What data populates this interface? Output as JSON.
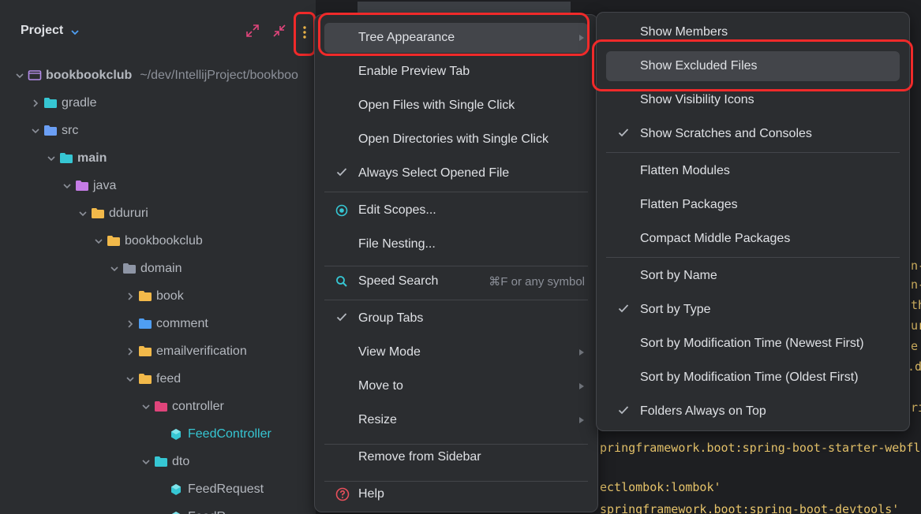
{
  "project_panel": {
    "title": "Project",
    "tree": [
      {
        "label": "bookbookclub",
        "path": "~/dev/IntellijProject/bookboo",
        "bold": true,
        "expanded": true,
        "icon": "module-folder-icon",
        "color": "#b38ce8"
      },
      {
        "label": "gradle",
        "expanded": false,
        "icon": "gradle-folder-icon",
        "color": "#36c6d3"
      },
      {
        "label": "src",
        "expanded": true,
        "icon": "source-folder-icon",
        "color": "#6b9ff5"
      },
      {
        "label": "main",
        "bold": true,
        "expanded": true,
        "icon": "main-folder-icon",
        "color": "#36c6d3"
      },
      {
        "label": "java",
        "expanded": true,
        "icon": "java-folder-icon",
        "color": "#c57ce6"
      },
      {
        "label": "ddururi",
        "expanded": true,
        "icon": "package-folder-icon",
        "color": "#f2b94a"
      },
      {
        "label": "bookbookclub",
        "expanded": true,
        "icon": "package-folder-icon",
        "color": "#f2b94a"
      },
      {
        "label": "domain",
        "expanded": true,
        "icon": "domain-folder-icon",
        "color": "#8e95a5"
      },
      {
        "label": "book",
        "expanded": false,
        "icon": "package-folder-icon",
        "color": "#f2b94a"
      },
      {
        "label": "comment",
        "expanded": false,
        "icon": "comment-folder-icon",
        "color": "#4f9ef2"
      },
      {
        "label": "emailverification",
        "expanded": false,
        "icon": "package-folder-icon",
        "color": "#f2b94a"
      },
      {
        "label": "feed",
        "expanded": true,
        "icon": "package-folder-icon",
        "color": "#f2b94a"
      },
      {
        "label": "controller",
        "expanded": true,
        "icon": "controller-folder-icon",
        "color": "#e0457b"
      },
      {
        "label": "FeedController",
        "cyan": true,
        "icon": "class-icon",
        "color": "#36c6d3"
      },
      {
        "label": "dto",
        "expanded": true,
        "icon": "dto-folder-icon",
        "color": "#36c6d3"
      },
      {
        "label": "FeedRequest",
        "icon": "class-icon",
        "color": "#36c6d3"
      },
      {
        "label": "FeedR",
        "icon": "class-icon",
        "color": "#36c6d3"
      }
    ]
  },
  "editor": {
    "lines": [
      {
        "text": "pringframework.boot:spring-boot-starter-webflux"
      },
      {
        "text": "ectlombok:lombok'"
      },
      {
        "text": "springframework.boot:spring-boot-devtools'"
      }
    ],
    "edge_fragments": [
      "n-",
      "n-",
      "th",
      "ur",
      "e",
      ".da",
      "ri"
    ]
  },
  "main_menu": {
    "items": [
      {
        "label": "Tree Appearance",
        "submenu": true,
        "highlight": true
      },
      {
        "label": "Enable Preview Tab"
      },
      {
        "label": "Open Files with Single Click"
      },
      {
        "label": "Open Directories with Single Click"
      },
      {
        "label": "Always Select Opened File",
        "checked": true
      },
      {
        "label": "Edit Scopes...",
        "icon": "target-icon"
      },
      {
        "label": "File Nesting..."
      },
      {
        "label": "Speed Search",
        "icon": "search-icon",
        "shortcut": "⌘F or any symbol"
      },
      {
        "label": "Group Tabs",
        "checked": true
      },
      {
        "label": "View Mode",
        "submenu": true
      },
      {
        "label": "Move to",
        "submenu": true
      },
      {
        "label": "Resize",
        "submenu": true
      },
      {
        "label": "Remove from Sidebar"
      },
      {
        "label": "Help",
        "icon": "help-icon"
      }
    ]
  },
  "sub_menu": {
    "items": [
      {
        "label": "Show Members"
      },
      {
        "label": "Show Excluded Files",
        "highlight": true
      },
      {
        "label": "Show Visibility Icons"
      },
      {
        "label": "Show Scratches and Consoles",
        "checked": true
      },
      {
        "label": "Flatten Modules"
      },
      {
        "label": "Flatten Packages"
      },
      {
        "label": "Compact Middle Packages"
      },
      {
        "label": "Sort by Name"
      },
      {
        "label": "Sort by Type",
        "checked": true
      },
      {
        "label": "Sort by Modification Time (Newest First)"
      },
      {
        "label": "Sort by Modification Time (Oldest First)"
      },
      {
        "label": "Folders Always on Top",
        "checked": true
      }
    ]
  },
  "colors": {
    "highlight": "#43454a",
    "annotation_red": "#f02a2a",
    "accent_cyan": "#36c6d3",
    "options_dots": "#f2b94a"
  }
}
